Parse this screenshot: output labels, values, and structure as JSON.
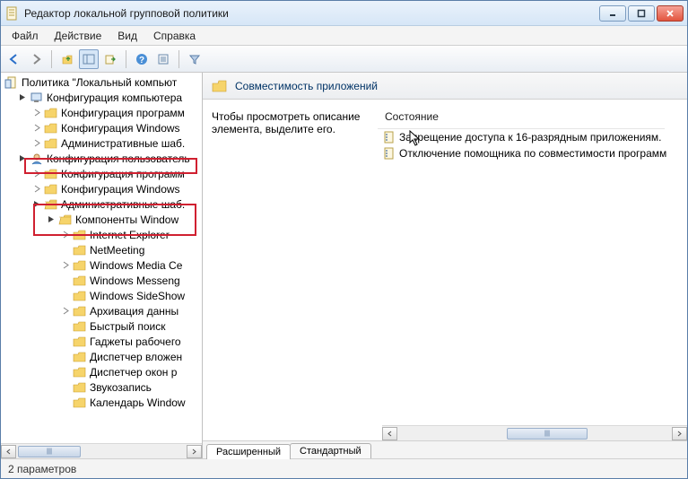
{
  "titlebar": {
    "title": "Редактор локальной групповой политики"
  },
  "menu": {
    "file": "Файл",
    "action": "Действие",
    "view": "Вид",
    "help": "Справка"
  },
  "tree": {
    "root": "Политика \"Локальный компьют",
    "comp_config": "Конфигурация компьютера",
    "comp_prog": "Конфигурация программ",
    "comp_win": "Конфигурация Windows",
    "comp_admin": "Административные шаб.",
    "user_config": "Конфигурация пользователь",
    "user_prog": "Конфигурация программ",
    "user_win": "Конфигурация Windows",
    "user_admin": "Административные шаб.",
    "components": "Компоненты Window",
    "ie": "Internet Explorer",
    "netmeeting": "NetMeeting",
    "wmc": "Windows Media Ce",
    "wmsg": "Windows Messeng",
    "sideshow": "Windows SideShow",
    "archive": "Архивация данны",
    "quicksearch": "Быстрый поиск",
    "gadgets": "Гаджеты рабочего",
    "attach_mgr": "Диспетчер вложен",
    "wnd_mgr": "Диспетчер окон р",
    "soundrec": "Звукозапись",
    "calendar": "Календарь Window"
  },
  "detail": {
    "header": "Совместимость приложений",
    "desc": "Чтобы просмотреть описание элемента, выделите его.",
    "state_col": "Состояние",
    "items": [
      "Запрещение доступа к 16-разрядным приложениям.",
      "Отключение помощника по совместимости программ"
    ]
  },
  "tabs": {
    "extended": "Расширенный",
    "standard": "Стандартный"
  },
  "status": "2 параметров"
}
